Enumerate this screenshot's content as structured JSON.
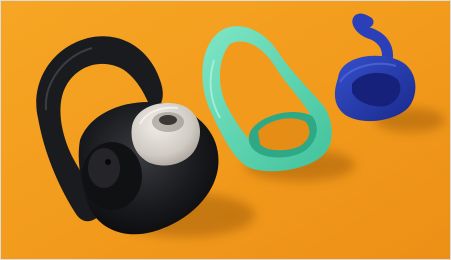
{
  "scene": {
    "subject": "earbud-with-interchangeable-ear-hooks",
    "colors": {
      "background": "#f29a1c",
      "earbud_body": "#16171a",
      "ear_tip": "#dcd8d2",
      "hook_black": "#1a1b1e",
      "hook_mint": "#5fd9b4",
      "hook_blue": "#2438a8"
    }
  }
}
